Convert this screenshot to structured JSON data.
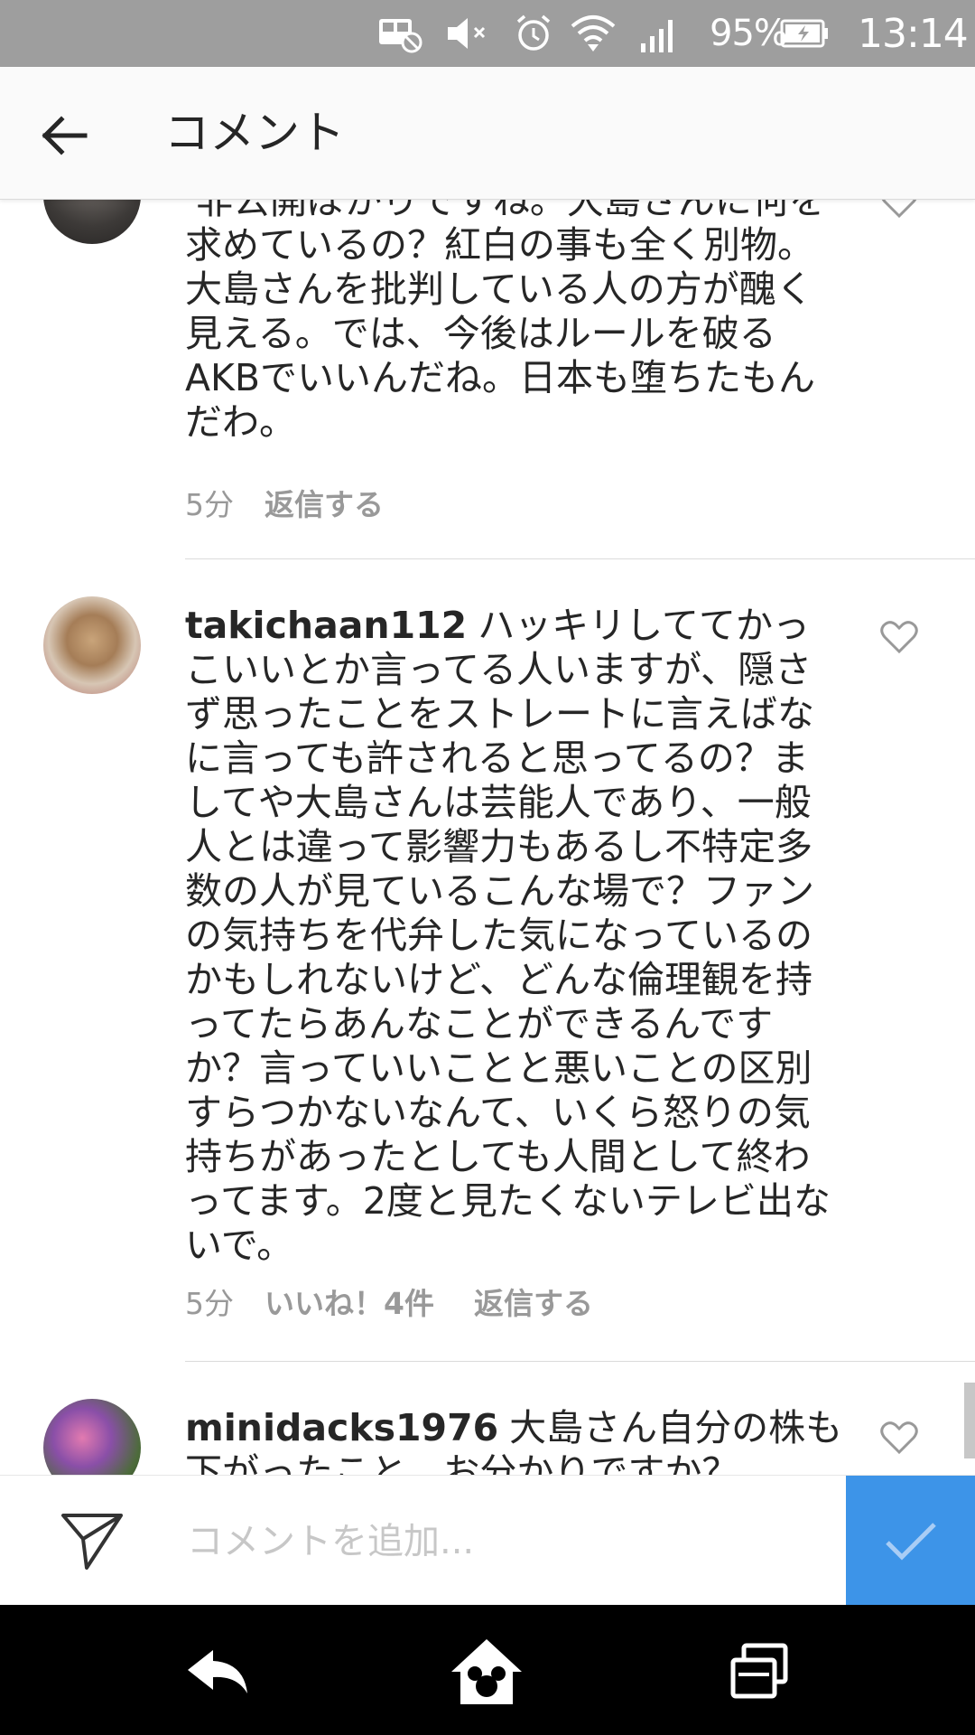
{
  "status_bar": {
    "battery": "95%",
    "time": "13:14"
  },
  "header": {
    "title": "コメント"
  },
  "comments": [
    {
      "username": "",
      "text": "非公開ばかりですね。大島さんに何を求めているの？紅白の事も全く別物。大島さんを批判している人の方が醜く見える。では、今後はルールを破るAKBでいいんだね。日本も堕ちたもんだわ。",
      "time": "5分",
      "likes": "",
      "reply": "返信する"
    },
    {
      "username": "takichaan112",
      "text": "ハッキリしててかっこいいとか言ってる人いますが、隠さず思ったことをストレートに言えばなに言っても許されると思ってるの？ましてや大島さんは芸能人であり、一般人とは違って影響力もあるし不特定多数の人が見ているこんな場で？ファンの気持ちを代弁した気になっているのかもしれないけど、どんな倫理観を持ってたらあんなことができるんですか？言っていいことと悪いことの区別すらつかないなんて、いくら怒りの気持ちがあったとしても人間として終わってます。2度と見たくないテレビ出ないで。",
      "time": "5分",
      "likes": "いいね！4件",
      "reply": "返信する"
    },
    {
      "username": "minidacks1976",
      "text": "大島さん自分の株も下がったこと、お分かりですか？",
      "time": "",
      "likes": "",
      "reply": ""
    }
  ],
  "input": {
    "placeholder": "コメントを追加..."
  },
  "colors": {
    "accent": "#3d94e8",
    "status_bar": "#9e9e9e",
    "meta_text": "#999999"
  },
  "icons": {
    "status": [
      "image-blocked-icon",
      "mute-icon",
      "alarm-icon",
      "wifi-icon",
      "signal-icon",
      "battery-charging-icon"
    ],
    "nav": [
      "back-nav-icon",
      "home-icon",
      "recent-apps-icon"
    ]
  }
}
